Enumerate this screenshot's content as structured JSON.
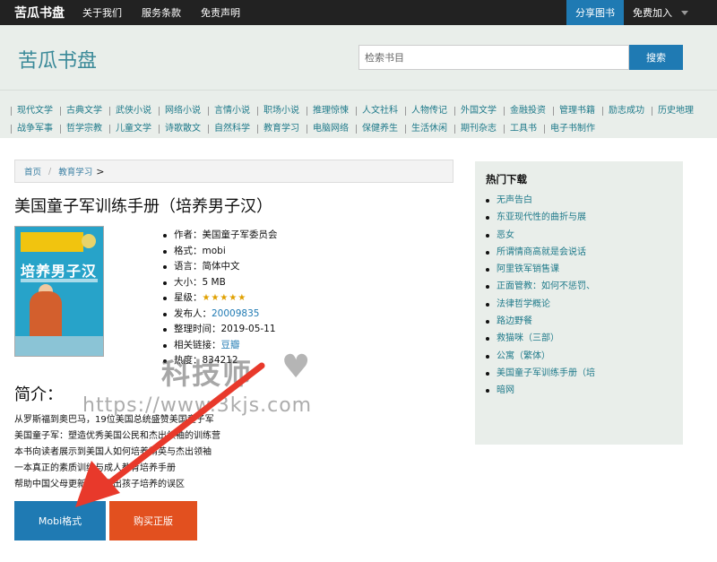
{
  "topbar": {
    "brand": "苦瓜书盘",
    "nav": [
      "关于我们",
      "服务条款",
      "免责声明"
    ],
    "share": "分享图书",
    "join": "免费加入"
  },
  "header": {
    "site_title": "苦瓜书盘",
    "search_placeholder": "检索书目",
    "search_button": "搜索"
  },
  "categories": [
    "现代文学",
    "古典文学",
    "武侠小说",
    "网络小说",
    "言情小说",
    "职场小说",
    "推理惊悚",
    "人文社科",
    "人物传记",
    "外国文学",
    "金融投资",
    "管理书籍",
    "励志成功",
    "历史地理",
    "战争军事",
    "哲学宗教",
    "儿童文学",
    "诗歌散文",
    "自然科学",
    "教育学习",
    "电脑网络",
    "保健养生",
    "生活休闲",
    "期刊杂志",
    "工具书",
    "电子书制作"
  ],
  "breadcrumb": {
    "home": "首页",
    "section": "教育学习",
    "gt": ">"
  },
  "book": {
    "title": "美国童子军训练手册（培养男子汉）",
    "cover_text": "培养男子汉",
    "meta": {
      "author_label": "作者：",
      "author": "美国童子军委员会",
      "format_label": "格式：",
      "format": "mobi",
      "language_label": "语言：",
      "language": "简体中文",
      "size_label": "大小：",
      "size": "5 MB",
      "rating_label": "星级：",
      "rating": 5,
      "publisher_label": "发布人：",
      "publisher": "20009835",
      "date_label": "整理时间：",
      "date": "2019-05-11",
      "links_label": "相关链接：",
      "links": "豆瓣",
      "heat_label": "热度：",
      "heat": "834212"
    }
  },
  "intro": {
    "heading": "简介：",
    "lines": [
      "从罗斯福到奥巴马，19位美国总统盛赞美国童子军",
      "美国童子军：塑造优秀美国公民和杰出领袖的训练营",
      "本书向读者展示到美国人如何培养精英与杰出领袖",
      "一本真正的素质训练与成人教育培养手册",
      "帮助中国父母更新观念走出孩子培养的误区"
    ]
  },
  "buttons": {
    "mobi": "Mobi格式",
    "buy": "购买正版"
  },
  "sidebar": {
    "title": "热门下载",
    "items": [
      "无声告白",
      "东亚现代性的曲折与展",
      "恶女",
      "所谓情商高就是会说话",
      "阿里铁军销售课",
      "正面管教：如何不惩罚、",
      "法律哲学概论",
      "路边野餐",
      "救猫咪（三部）",
      "公寓（繁体）",
      "美国童子军训练手册（培",
      "暗网"
    ]
  },
  "watermark": {
    "logo": "科技师",
    "url": "https://www.3kjs.com"
  },
  "colors": {
    "accent": "#1f7ab3",
    "buy": "#e2501f",
    "header_bg": "#e9eeea",
    "topbar": "#222222",
    "arrow": "#e8392b"
  }
}
